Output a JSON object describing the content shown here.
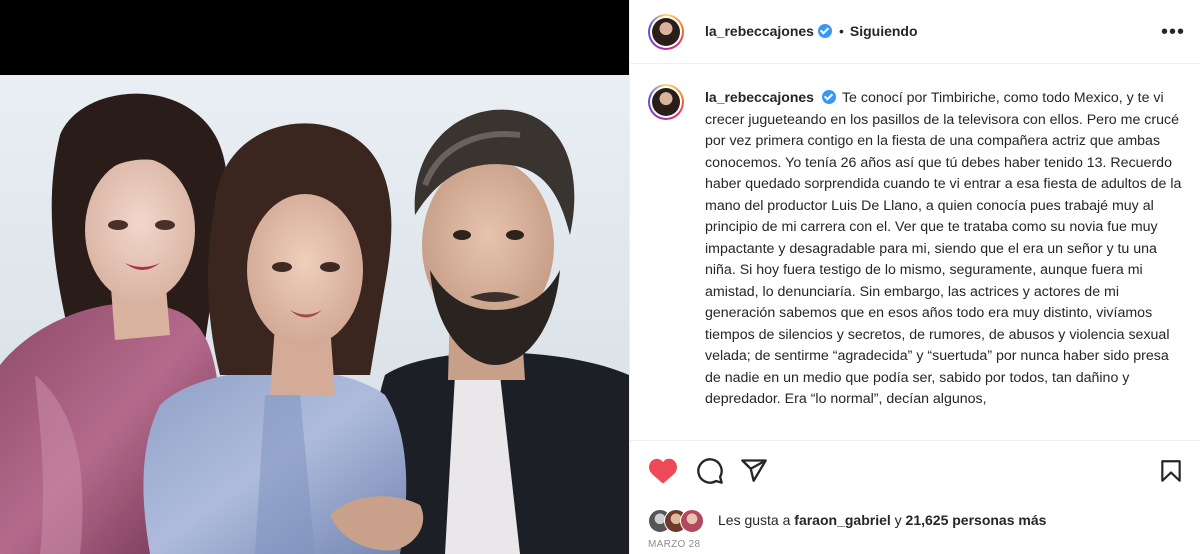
{
  "post": {
    "username": "la_rebeccajones",
    "follow_status": "Siguiendo",
    "more_label": "•••",
    "caption": "Te conocí por Timbiriche, como todo Mexico, y te vi crecer jugueteando en los pasillos de la televisora con ellos. Pero me crucé por vez primera contigo en la fiesta de una compañera actriz que ambas conocemos. Yo tenía 26 años así que tú debes haber tenido 13. Recuerdo haber quedado sorprendida cuando te vi entrar a esa fiesta de adultos de la mano del productor Luis De Llano, a quien conocía pues trabajé muy al principio de mi carrera con el. Ver que te trataba como su novia fue muy impactante y desagradable para mi, siendo que el era un señor y tu una niña. Si hoy fuera testigo de lo mismo, seguramente, aunque fuera mi amistad, lo denunciaría. Sin embargo, las actrices y actores de mi generación sabemos que en esos años todo era muy distinto, vivíamos tiempos de silencios y secretos, de rumores, de abusos y violencia sexual velada; de sentirme “agradecida” y “suertuda” por nunca haber sido presa de nadie en un medio que podía ser, sabido por todos, tan dañino y depredador. Era “lo normal”, decían algunos,",
    "likes_prefix": "Les gusta a",
    "likes_user": "faraon_gabriel",
    "likes_middle": "y",
    "likes_count": "21,625 personas más",
    "date": "MARZO 28"
  },
  "icons": {
    "like": "heart-icon",
    "comment": "comment-icon",
    "share": "share-icon",
    "save": "bookmark-icon",
    "verified": "verified-badge-icon"
  },
  "colors": {
    "like_red": "#ed4956",
    "verified_blue": "#3897f0",
    "muted": "#8e8e8e"
  }
}
